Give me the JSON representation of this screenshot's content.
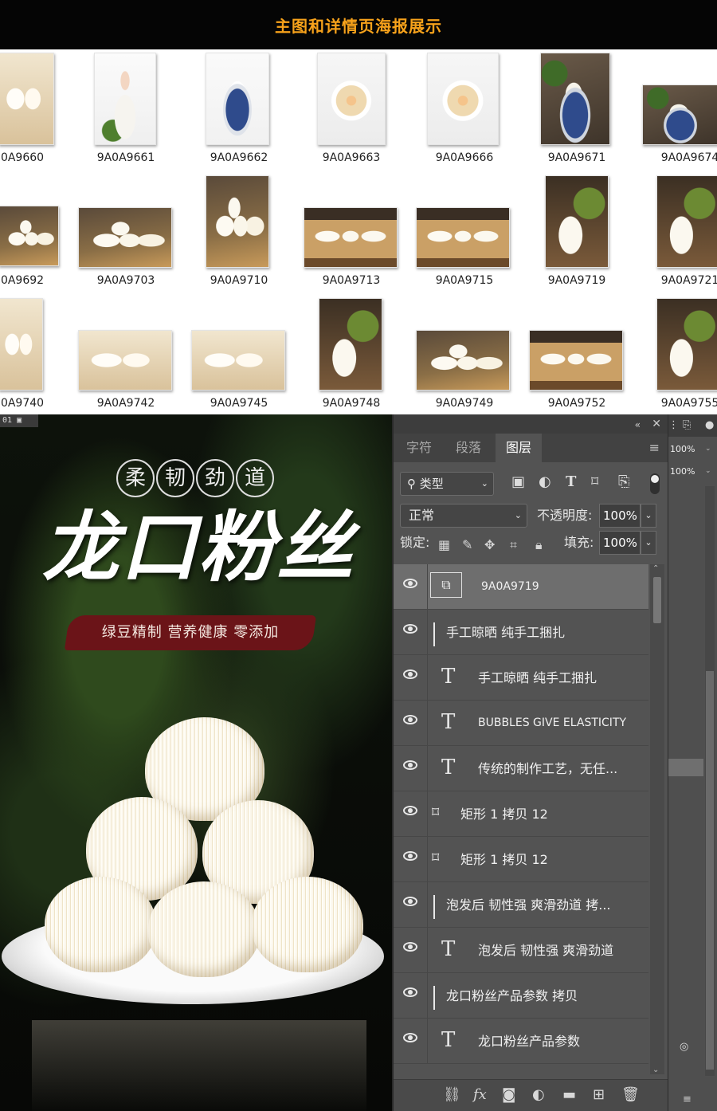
{
  "banner": {
    "title": "主图和详情页海报展示"
  },
  "thumbnails": {
    "row1": [
      "0A9660",
      "9A0A9661",
      "9A0A9662",
      "9A0A9663",
      "9A0A9666",
      "9A0A9671",
      "9A0A9674"
    ],
    "row2": [
      "0A9692",
      "9A0A9703",
      "9A0A9710",
      "9A0A9713",
      "9A0A9715",
      "9A0A9719",
      "9A0A9721"
    ],
    "row3": [
      "0A9740",
      "9A0A9742",
      "9A0A9745",
      "9A0A9748",
      "9A0A9749",
      "9A0A9752",
      "9A0A9755"
    ]
  },
  "poster": {
    "doc_tab": "01",
    "badges": [
      "柔",
      "韧",
      "劲",
      "道"
    ],
    "headline": "龙口粉丝",
    "slogan": "绿豆精制 营养健康 零添加"
  },
  "photoshop": {
    "tabs": [
      "字符",
      "段落",
      "图层"
    ],
    "active_tab": "图层",
    "filter_kind": "类型",
    "blend_mode": "正常",
    "opacity_label": "不透明度:",
    "opacity_value": "100%",
    "lock_label": "锁定:",
    "fill_label": "填充:",
    "fill_value": "100%",
    "layers": [
      {
        "name": "9A0A9719",
        "type": "smart",
        "selected": true
      },
      {
        "name": "手工晾晒 纯手工捆扎",
        "type": "group"
      },
      {
        "name": "手工晾晒 纯手工捆扎",
        "type": "text"
      },
      {
        "name": "BUBBLES GIVE ELASTICITY",
        "type": "text"
      },
      {
        "name": "传统的制作工艺，无任...",
        "type": "text"
      },
      {
        "name": "矩形 1 拷贝 12",
        "type": "shape"
      },
      {
        "name": "矩形 1 拷贝 12",
        "type": "shape"
      },
      {
        "name": "泡发后 韧性强 爽滑劲道 拷...",
        "type": "group"
      },
      {
        "name": "泡发后 韧性强 爽滑劲道",
        "type": "text"
      },
      {
        "name": "龙口粉丝产品参数 拷贝",
        "type": "group"
      },
      {
        "name": "龙口粉丝产品参数",
        "type": "text"
      }
    ]
  },
  "strip": {
    "zoom1": "100%",
    "zoom2": "100%"
  }
}
